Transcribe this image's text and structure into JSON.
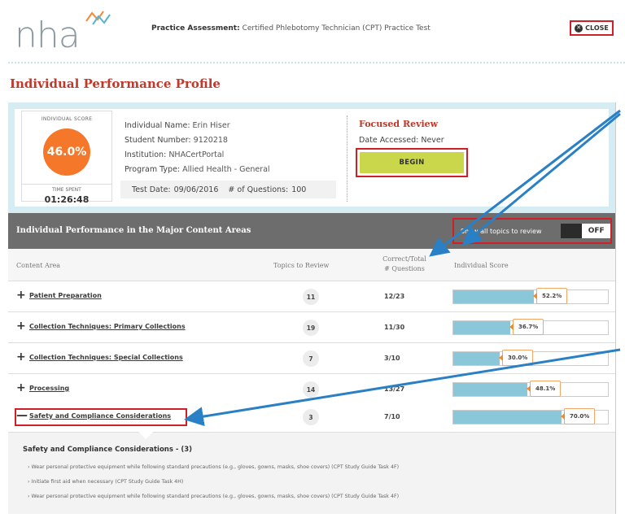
{
  "header": {
    "logo_text": "nha",
    "practice_label": "Practice Assessment:",
    "practice_name": "Certified Phlebotomy Technician (CPT) Practice Test",
    "close_label": "CLOSE",
    "close_icon": "close-icon"
  },
  "page_title": "Individual Performance Profile",
  "summary": {
    "score_label": "INDIVIDUAL SCORE",
    "score_value": "46.0%",
    "time_label": "TIME SPENT",
    "time_value": "01:26:48",
    "name_key": "Individual Name:",
    "name_val": "Erin Hiser",
    "student_key": "Student Number:",
    "student_val": "9120218",
    "institution_key": "Institution:",
    "institution_val": "NHACertPortal",
    "program_key": "Program Type:",
    "program_val": "Allied Health - General",
    "test_date_key": "Test Date:",
    "test_date_val": "09/06/2016",
    "questions_key": "# of Questions:",
    "questions_val": "100"
  },
  "focused": {
    "title": "Focused Review",
    "date_key": "Date Accessed:",
    "date_val": "Never",
    "begin_label": "BEGIN"
  },
  "major": {
    "title": "Individual Performance in the Major Content Areas",
    "toggle_text": "Show all topics to review",
    "toggle_state": "OFF"
  },
  "columns": {
    "content_area": "Content Area",
    "topics": "Topics to Review",
    "correct_1": "Correct/Total",
    "correct_2": "# Questions",
    "score": "Individual Score"
  },
  "rows": [
    {
      "sign": "+",
      "topic": "Patient Preparation",
      "topics": "11",
      "ratio": "12/23",
      "score": "52.2%",
      "fraction": 0.522
    },
    {
      "sign": "+",
      "topic": "Collection Techniques: Primary Collections",
      "topics": "19",
      "ratio": "11/30",
      "score": "36.7%",
      "fraction": 0.367
    },
    {
      "sign": "+",
      "topic": "Collection Techniques: Special Collections",
      "topics": "7",
      "ratio": "3/10",
      "score": "30.0%",
      "fraction": 0.3
    },
    {
      "sign": "+",
      "topic": "Processing",
      "topics": "14",
      "ratio": "13/27",
      "score": "48.1%",
      "fraction": 0.481
    },
    {
      "sign": "—",
      "topic": "Safety and Compliance Considerations",
      "topics": "3",
      "ratio": "7/10",
      "score": "70.0%",
      "fraction": 0.7
    }
  ],
  "detail": {
    "title": "Safety and Compliance Considerations - (3)",
    "items": [
      "Wear personal protective equipment while following standard precautions (e.g., gloves, gowns, masks, shoe covers) (CPT Study Guide Task 4F)",
      "Initiate first aid when necessary (CPT Study Guide Task 4H)",
      "Wear personal protective equipment while following standard precautions (e.g., gloves, gowns, masks, shoe covers) (CPT Study Guide Task 4F)"
    ]
  },
  "colors": {
    "accent_red": "#c0392b",
    "highlight_red": "#d21f27",
    "score_orange": "#f5782a",
    "bar_blue": "#8ac7d9",
    "begin_green": "#cbd74b",
    "arrow_blue": "#2a80c4"
  }
}
